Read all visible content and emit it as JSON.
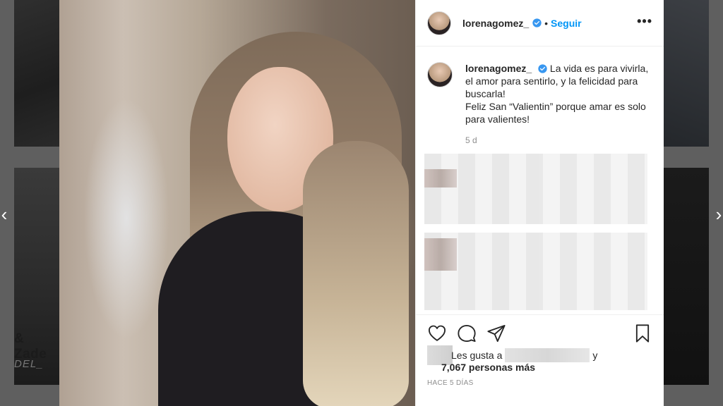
{
  "background": {
    "left_tile_text": "& Zade",
    "left_tile_sub": "DEL_"
  },
  "navigation": {
    "prev_icon": "chevron-left-icon",
    "next_icon": "chevron-right-icon"
  },
  "header": {
    "username": "lorenagomez_",
    "verified_icon": "verified-badge-icon",
    "separator": "•",
    "follow_label": "Seguir",
    "more_icon": "more-options-icon"
  },
  "caption": {
    "username": "lorenagomez_",
    "text_line1": "La vida es para vivirla, el amor para sentirlo, y la felicidad para buscarla!",
    "text_line2": "Feliz San “Valientin” porque amar es solo para valientes!",
    "time": "5 d"
  },
  "actions": {
    "like_icon": "heart-icon",
    "comment_icon": "comment-icon",
    "share_icon": "paper-plane-icon",
    "save_icon": "bookmark-icon"
  },
  "likes": {
    "prefix": "Les gusta a",
    "suffix": "y",
    "count_text": "7,067 personas más"
  },
  "posted_time": "HACE 5 DÍAS",
  "colors": {
    "accent": "#0095f6",
    "verified": "#3897f0",
    "text": "#262626",
    "muted": "#8e8e8e",
    "overlay": "#5f5f5f"
  }
}
